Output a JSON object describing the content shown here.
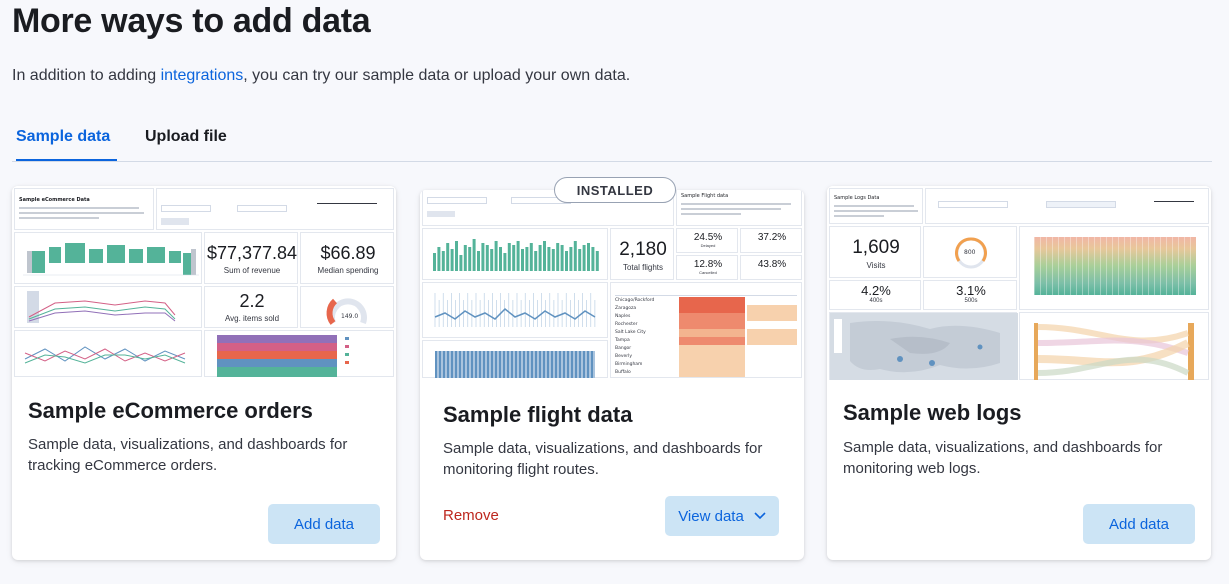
{
  "header": {
    "title": "More ways to add data",
    "intro_before": "In addition to adding ",
    "intro_link": "integrations",
    "intro_after": ", you can try our sample data or upload your own data."
  },
  "tabs": [
    {
      "label": "Sample data",
      "active": true
    },
    {
      "label": "Upload file",
      "active": false
    }
  ],
  "colors": {
    "accent": "#0b64dd",
    "danger": "#bd271e",
    "button_bg": "#cce4f5",
    "chart_green": "#54b399",
    "chart_blue": "#6092c0"
  },
  "cards": [
    {
      "title": "Sample eCommerce orders",
      "description": "Sample data, visualizations, and dashboards for tracking eCommerce orders.",
      "primary_action": "Add data",
      "thumbnail": {
        "dashboard_title": "Sample eCommerce Data",
        "metrics": [
          {
            "value": "$77,377.84",
            "label": "Sum of revenue"
          },
          {
            "value": "$66.89",
            "label": "Median spending"
          },
          {
            "value": "2.2",
            "label": "Avg. items sold"
          }
        ],
        "gauge_value": "149.0"
      }
    },
    {
      "title": "Sample flight data",
      "description": "Sample data, visualizations, and dashboards for monitoring flight routes.",
      "badge": "INSTALLED",
      "secondary_action": "Remove",
      "primary_action": "View data",
      "primary_icon": "chevron-down-icon",
      "thumbnail": {
        "dashboard_title": "Sample Flight data",
        "metrics": [
          {
            "value": "2,180",
            "label": "Total flights"
          },
          {
            "value": "24.5%",
            "label": "Delayed"
          },
          {
            "value": "37.2%",
            "label": ""
          },
          {
            "value": "12.8%",
            "label": "Cancelled"
          },
          {
            "value": "43.8%",
            "label": ""
          }
        ],
        "cities": [
          "Chicago/Rockford",
          "Zaragoza",
          "Naples",
          "Rochester",
          "Salt Lake City",
          "Tampa",
          "Bangor",
          "Beverly",
          "Birmingham",
          "Buffalo"
        ]
      }
    },
    {
      "title": "Sample web logs",
      "description": "Sample data, visualizations, and dashboards for monitoring web logs.",
      "primary_action": "Add data",
      "thumbnail": {
        "dashboard_title": "Sample Logs Data",
        "metrics": [
          {
            "value": "1,609",
            "label": "Visits"
          },
          {
            "value": "4.2%",
            "label": "400s"
          },
          {
            "value": "3.1%",
            "label": "500s"
          }
        ],
        "gauge_value": "800"
      }
    }
  ]
}
